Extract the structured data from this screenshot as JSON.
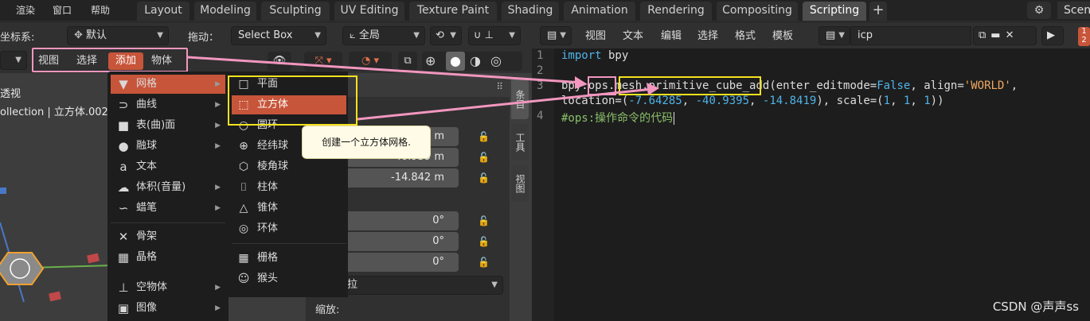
{
  "topbar": {
    "menu": [
      "渲染",
      "窗口",
      "帮助"
    ],
    "tabs": [
      "Layout",
      "Modeling",
      "Sculpting",
      "UV Editing",
      "Texture Paint",
      "Shading",
      "Animation",
      "Rendering",
      "Compositing",
      "Scripting"
    ],
    "active_tab": "Scripting",
    "add_tab": "+",
    "scene_label": "Scen"
  },
  "viewport_header": {
    "coord_label": "坐标系:",
    "coord_value": "默认",
    "drag_label": "拖动：",
    "drag_value": "Select Box",
    "transform_value": "全局"
  },
  "viewport_menu": [
    "视图",
    "选择",
    "添加",
    "物体"
  ],
  "viewport_overlay": {
    "view_name": "透视",
    "collection_text": "ollection | 立方体.002"
  },
  "add_menu": [
    {
      "label": "网格",
      "icon": "mesh-icon",
      "glyph": "▼",
      "submenu": true
    },
    {
      "label": "曲线",
      "icon": "curve-icon",
      "glyph": "⊃",
      "submenu": true
    },
    {
      "label": "表(曲)面",
      "icon": "surface-icon",
      "glyph": "■",
      "submenu": true
    },
    {
      "label": "融球",
      "icon": "metaball-icon",
      "glyph": "●",
      "submenu": true
    },
    {
      "label": "文本",
      "icon": "text-icon",
      "glyph": "a",
      "submenu": false
    },
    {
      "label": "体积(音量)",
      "icon": "volume-icon",
      "glyph": "☁",
      "submenu": true
    },
    {
      "label": "蜡笔",
      "icon": "grease-pencil-icon",
      "glyph": "∽",
      "submenu": true
    },
    {
      "label": "骨架",
      "icon": "armature-icon",
      "glyph": "✕",
      "submenu": false
    },
    {
      "label": "晶格",
      "icon": "lattice-icon",
      "glyph": "▦",
      "submenu": false
    },
    {
      "label": "空物体",
      "icon": "empty-icon",
      "glyph": "⊥",
      "submenu": true
    },
    {
      "label": "图像",
      "icon": "image-icon",
      "glyph": "▣",
      "submenu": true
    }
  ],
  "mesh_submenu": [
    {
      "label": "平面",
      "icon": "plane-icon",
      "glyph": "□"
    },
    {
      "label": "立方体",
      "icon": "cube-icon",
      "glyph": "⬚"
    },
    {
      "label": "圆环",
      "icon": "circle-icon",
      "glyph": "○"
    },
    {
      "label": "经纬球",
      "icon": "uv-sphere-icon",
      "glyph": "⊕"
    },
    {
      "label": "棱角球",
      "icon": "ico-sphere-icon",
      "glyph": "⬡"
    },
    {
      "label": "柱体",
      "icon": "cylinder-icon",
      "glyph": "⌷"
    },
    {
      "label": "锥体",
      "icon": "cone-icon",
      "glyph": "△"
    },
    {
      "label": "环体",
      "icon": "torus-icon",
      "glyph": "◎"
    },
    {
      "label": "栅格",
      "icon": "grid-icon",
      "glyph": "▦"
    },
    {
      "label": "猴头",
      "icon": "monkey-icon",
      "glyph": "☺"
    }
  ],
  "tooltip": "创建一个立方体网格.",
  "npanel": {
    "loc_values": [
      "m",
      "-40.939 m",
      "-14.842 m"
    ],
    "rot_values": [
      "0°",
      "0°",
      "0°"
    ],
    "rot_mode": "欧拉",
    "scale_label": "缩放:",
    "tabs": [
      "条目",
      "工具",
      "视图"
    ]
  },
  "editor": {
    "menu": [
      "视图",
      "文本",
      "编辑",
      "选择",
      "格式",
      "模板"
    ],
    "filename": "icp",
    "lines": [
      "1",
      "2",
      "3",
      "4"
    ],
    "code": {
      "l1_kw": "import",
      "l1_rest": " bpy",
      "l3_pre": "bpy.",
      "l3_ops": "ops",
      "l3_dot": ".",
      "l3_fn": "mesh.primitive_cube",
      "l3_a": "_add(enter_editmode=",
      "l3_false": "False",
      "l3_b": ", align=",
      "l3_world": "'WORLD'",
      "l3_c": ",",
      "l3b_a": "location=(",
      "l3b_n1": "-7.64285",
      "l3b_b": ", ",
      "l3b_n2": "-40.9395",
      "l3b_c": ", ",
      "l3b_n3": "-14.8419",
      "l3b_d": "), scale=(",
      "l3b_n4": "1",
      "l3b_e": ", ",
      "l3b_n5": "1",
      "l3b_f": ", ",
      "l3b_n6": "1",
      "l3b_g": "))",
      "l4": "#ops:操作命令的代码"
    }
  },
  "watermark": "CSDN @声声ss",
  "colors": {
    "highlight": "#c7553a",
    "pink_annot": "#f297bf",
    "yellow_annot": "#f4e21e"
  }
}
